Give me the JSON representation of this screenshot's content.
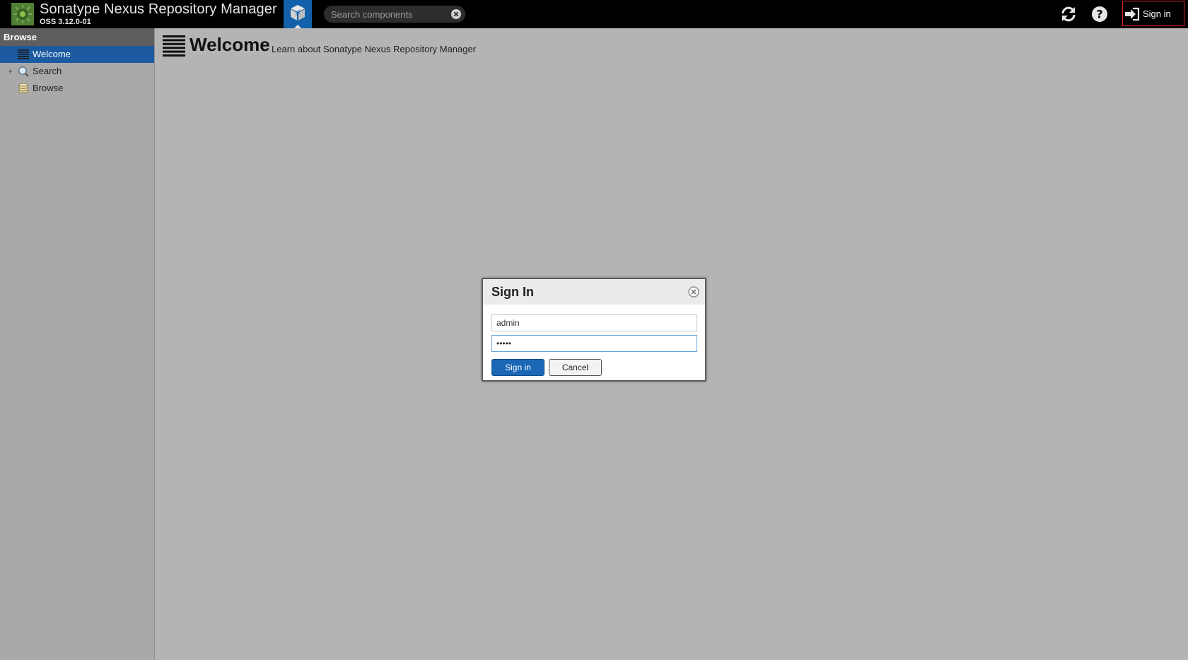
{
  "header": {
    "app_title": "Sonatype Nexus Repository Manager",
    "version": "OSS 3.12.0-01",
    "logo_icon": "nexus-logo-icon",
    "browse_mode_icon": "cube-icon",
    "search": {
      "placeholder": "Search components",
      "value": ""
    },
    "refresh_icon": "refresh-icon",
    "help_icon": "help-icon",
    "signin_label": "Sign in"
  },
  "sidebar": {
    "title": "Browse",
    "items": [
      {
        "label": "Welcome",
        "icon": "welcome-list-icon",
        "selected": true
      },
      {
        "label": "Search",
        "icon": "magnifier-icon",
        "expandable": true,
        "expander": "+"
      },
      {
        "label": "Browse",
        "icon": "database-icon"
      }
    ]
  },
  "main": {
    "title": "Welcome",
    "subtitle": "Learn about Sonatype Nexus Repository Manager"
  },
  "dialog": {
    "title": "Sign In",
    "username_value": "admin",
    "password_value": "•••••",
    "signin_label": "Sign in",
    "cancel_label": "Cancel"
  },
  "colors": {
    "header_bg": "#000000",
    "browse_mode_bg": "#1160a9",
    "selected_item_bg": "#1b5aa0",
    "primary_button": "#1b67b6",
    "signin_highlight_border": "#e0262b",
    "background": "#b4b4b4"
  }
}
